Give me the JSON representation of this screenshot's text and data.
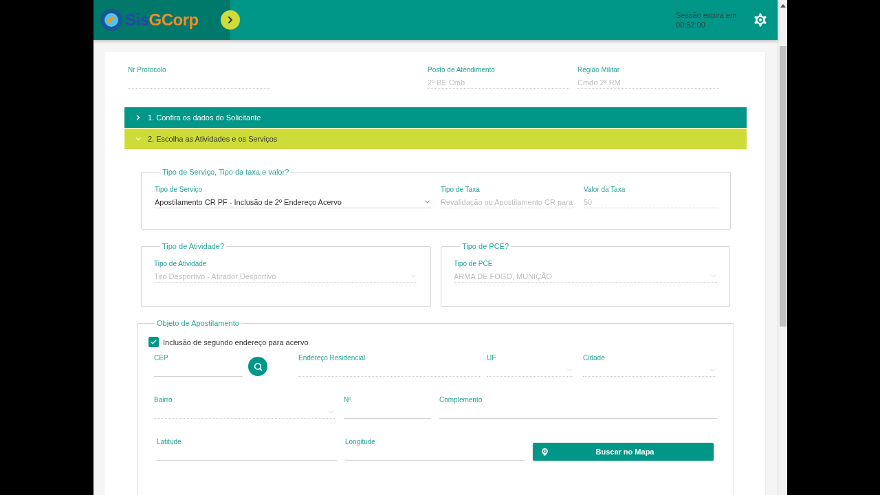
{
  "header": {
    "logo": {
      "prefix": "Sis",
      "suffix": "GCorp"
    },
    "session": {
      "label": "Sessão expira em",
      "time": "00:52:00"
    }
  },
  "top_fields": [
    {
      "label": "Nr Protocolo",
      "disabled": true
    },
    {
      "label": "Posto de Atendimento",
      "value": "2º BE Cmb",
      "disabled": true
    },
    {
      "label": "Região Militar",
      "value": "Cmdo 2ª RM",
      "disabled": true
    }
  ],
  "sections": [
    {
      "title": "1. Confira os dados do Solicitante",
      "expanded": false
    },
    {
      "title": "2. Escolha as Atividades e os Serviços",
      "expanded": true,
      "content": {
        "service_group": {
          "legend": "Tipo de Serviço, Tipo da taxa e valor?",
          "fields": [
            {
              "label": "Tipo de Serviço",
              "value": "Apostilamento CR PF - Inclusão de 2º Endereço Acervo",
              "kind": "select",
              "disabled": false
            },
            {
              "label": "Tipo de Taxa",
              "value": "Revalidação ou Apostilamento CR para",
              "kind": "text",
              "disabled": true
            },
            {
              "label": "Valor da Taxa",
              "value": "50",
              "kind": "text",
              "disabled": true
            }
          ]
        },
        "activity_group": {
          "legend": "Tipo de Atividade?",
          "field": {
            "label": "Tipo de Atividade",
            "value": "Tiro Desportivo - Atirador Desportivo",
            "kind": "select",
            "disabled": true
          }
        },
        "pce_group": {
          "legend": "Tipo de PCE?",
          "field": {
            "label": "Tipo de PCE",
            "value": "ARMA DE FOGO, MUNIÇÃO",
            "kind": "select",
            "disabled": true
          }
        },
        "object_group": {
          "legend": "Objeto de Apostilamento",
          "checkbox": {
            "label": "Inclusão de segundo endereço para acervo",
            "checked": true
          },
          "rows": [
            [
              {
                "label": "CEP",
                "kind": "text",
                "disabled": false
              },
              {
                "label": "Endereço Residencial",
                "kind": "text",
                "disabled": true
              },
              {
                "label": "UF",
                "kind": "select",
                "disabled": true
              },
              {
                "label": "Cidade",
                "kind": "select",
                "disabled": true
              }
            ],
            [
              {
                "label": "Bairro",
                "kind": "select",
                "disabled": true
              },
              {
                "label": "Nº",
                "kind": "text",
                "disabled": false
              },
              {
                "label": "Complemento",
                "kind": "text",
                "disabled": false
              }
            ],
            [
              {
                "label": "Latitude",
                "kind": "text",
                "disabled": false
              },
              {
                "label": "Longitude",
                "kind": "text",
                "disabled": false
              }
            ]
          ],
          "map_button": {
            "label": "Buscar no Mapa"
          }
        }
      }
    }
  ]
}
